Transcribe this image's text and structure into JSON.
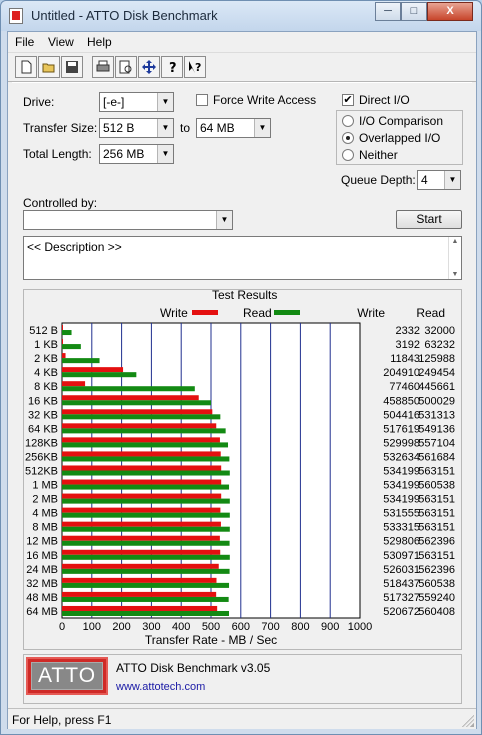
{
  "window": {
    "title": "Untitled - ATTO Disk Benchmark",
    "buttons": [
      "─",
      "□",
      "X"
    ]
  },
  "menu": [
    "File",
    "View",
    "Help"
  ],
  "toolbar": [
    "new-icon",
    "open-icon",
    "save-icon",
    "print-icon",
    "print-preview-icon",
    "move-icon",
    "help-icon",
    "context-help-icon"
  ],
  "form": {
    "drive_label": "Drive:",
    "drive_value": "[-e-]",
    "force_write_label": "Force Write Access",
    "direct_io_label": "Direct I/O",
    "direct_io_checked": "✔",
    "transfer_size_label": "Transfer Size:",
    "transfer_from": "512 B",
    "transfer_to_label": "to",
    "transfer_to": "64 MB",
    "total_length_label": "Total Length:",
    "total_length": "256 MB",
    "io_comparison_label": "I/O Comparison",
    "overlapped_io_label": "Overlapped I/O",
    "neither_label": "Neither",
    "queue_depth_label": "Queue Depth:",
    "queue_depth": "4",
    "controlled_by_label": "Controlled by:",
    "controlled_by_value": "",
    "start_label": "Start",
    "description": "<< Description >>",
    "scroll_up": "▲",
    "scroll_down": "▼"
  },
  "results": {
    "group_title": "Test Results",
    "legend_write": "Write",
    "legend_read": "Read",
    "col_write": "Write",
    "col_read": "Read",
    "write_values": [
      "2332",
      "3192",
      "11843",
      "204910",
      "77460",
      "458850",
      "504416",
      "517619",
      "529998",
      "532634",
      "534199",
      "534199",
      "534199",
      "531555",
      "533315",
      "529806",
      "530971",
      "526031",
      "518437",
      "517327",
      "520672"
    ],
    "read_values": [
      "32000",
      "63232",
      "125988",
      "249454",
      "445661",
      "500029",
      "531313",
      "549136",
      "557104",
      "561684",
      "563151",
      "560538",
      "563151",
      "563151",
      "563151",
      "562396",
      "563151",
      "562396",
      "560538",
      "559240",
      "560408"
    ]
  },
  "chart_data": {
    "type": "bar",
    "orientation": "horizontal",
    "categories": [
      "512 B",
      "1 KB",
      "2 KB",
      "4 KB",
      "8 KB",
      "16 KB",
      "32 KB",
      "64 KB",
      "128KB",
      "256KB",
      "512KB",
      "1 MB",
      "2 MB",
      "4 MB",
      "8 MB",
      "12 MB",
      "16 MB",
      "24 MB",
      "32 MB",
      "48 MB",
      "64 MB"
    ],
    "series": [
      {
        "name": "Write",
        "color": "#e41010",
        "values": [
          2.332,
          3.192,
          11.843,
          204.91,
          77.46,
          458.85,
          504.416,
          517.619,
          529.998,
          532.634,
          534.199,
          534.199,
          534.199,
          531.555,
          533.315,
          529.806,
          530.971,
          526.031,
          518.437,
          517.327,
          520.672
        ]
      },
      {
        "name": "Read",
        "color": "#138a13",
        "values": [
          32.0,
          63.232,
          125.988,
          249.454,
          445.661,
          500.029,
          531.313,
          549.136,
          557.104,
          561.684,
          563.151,
          560.538,
          563.151,
          563.151,
          563.151,
          562.396,
          563.151,
          562.396,
          560.538,
          559.24,
          560.408
        ]
      }
    ],
    "xlabel": "Transfer Rate - MB / Sec",
    "ylabel": "",
    "xticks": [
      "0",
      "100",
      "200",
      "300",
      "400",
      "500",
      "600",
      "700",
      "800",
      "900",
      "1000"
    ],
    "xlim": [
      0,
      1000
    ],
    "grid": true,
    "gridline_color": "#1f2f8f"
  },
  "footer": {
    "logo_text": "ATTO",
    "app_name": "ATTO Disk Benchmark v3.05",
    "website": "www.attotech.com"
  },
  "status": "For Help, press F1"
}
